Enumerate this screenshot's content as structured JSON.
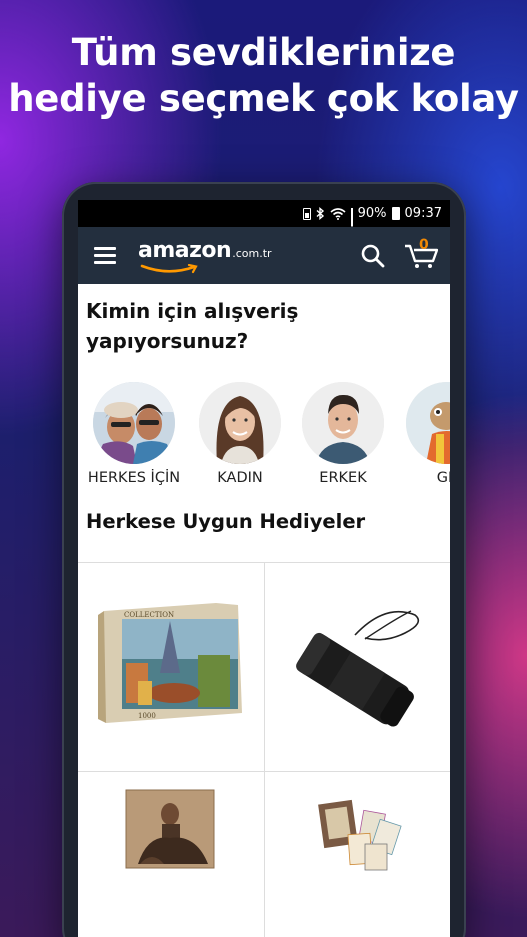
{
  "headline": {
    "line1": "Tüm sevdiklerinize",
    "line2": "hediye seçmek çok kolay"
  },
  "status_bar": {
    "wifi_icon": "wifi-icon",
    "battery_percent": "90%",
    "time": "09:37"
  },
  "header": {
    "logo_word": "amazon",
    "logo_tld": ".com.tr",
    "cart_count": "0"
  },
  "question": {
    "line1": "Kimin için alışveriş",
    "line2": "yapıyorsunuz?"
  },
  "shoppers": [
    {
      "label": "HERKES İÇİN"
    },
    {
      "label": "KADIN"
    },
    {
      "label": "ERKEK"
    },
    {
      "label": "GE"
    }
  ],
  "section_title": "Herkese Uygun Hediyeler",
  "products": [
    {
      "icon": "puzzle-box-image",
      "box_text_top": "COLLECTION",
      "box_text_bottom": "1000"
    },
    {
      "icon": "monocular-image"
    },
    {
      "icon": "portrait-puzzle-image"
    },
    {
      "icon": "tarot-cards-image"
    }
  ],
  "colors": {
    "topbar": "#232f3e",
    "cart_accent": "#f08804",
    "logo_smile": "#ff9900"
  }
}
